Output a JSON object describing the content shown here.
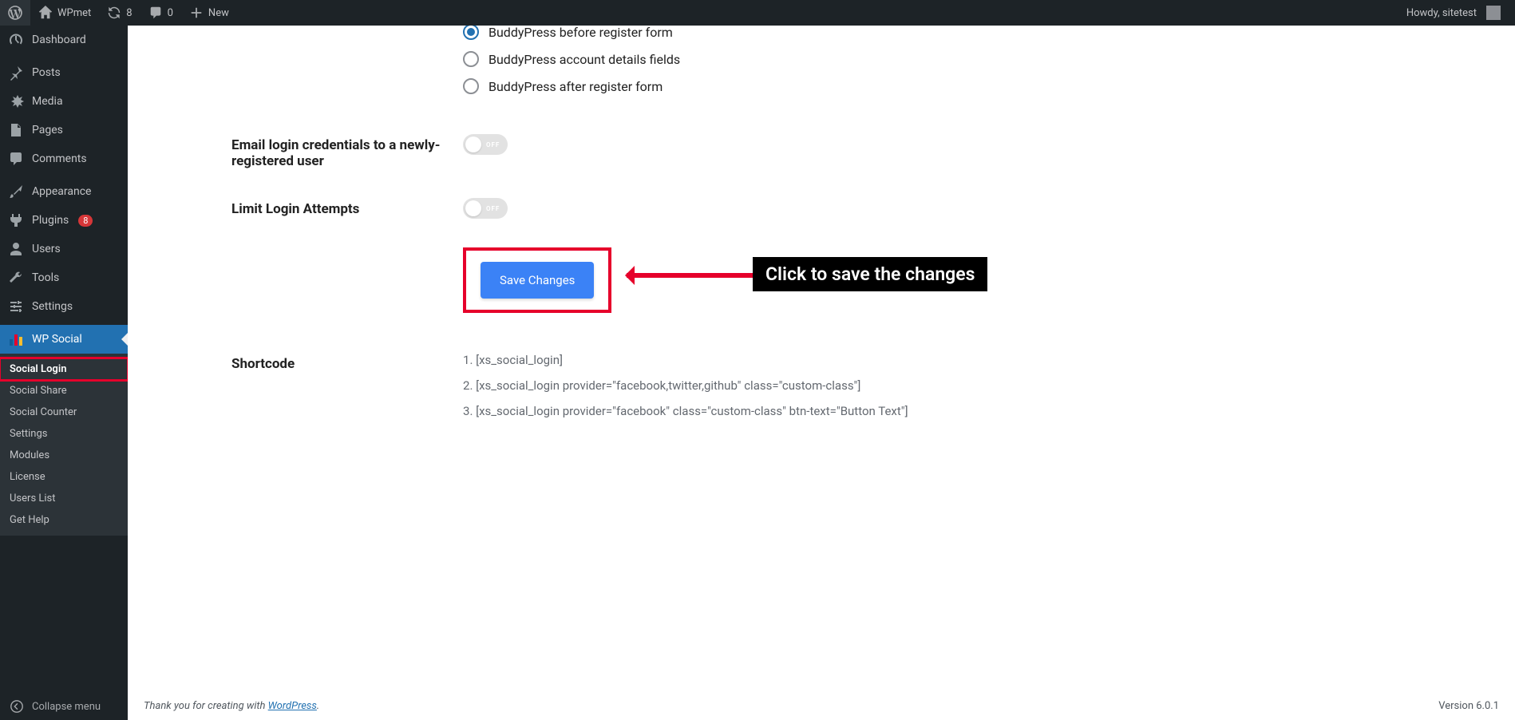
{
  "adminbar": {
    "site_name": "WPmet",
    "updates_count": "8",
    "comments_count": "0",
    "new_label": "New",
    "howdy": "Howdy, sitetest"
  },
  "sidebar": {
    "dashboard": "Dashboard",
    "posts": "Posts",
    "media": "Media",
    "pages": "Pages",
    "comments": "Comments",
    "appearance": "Appearance",
    "plugins": "Plugins",
    "plugins_badge": "8",
    "users": "Users",
    "tools": "Tools",
    "settings": "Settings",
    "wpsocial": "WP Social",
    "submenu": {
      "social_login": "Social Login",
      "social_share": "Social Share",
      "social_counter": "Social Counter",
      "settings": "Settings",
      "modules": "Modules",
      "license": "License",
      "users_list": "Users List",
      "get_help": "Get Help"
    },
    "collapse": "Collapse menu"
  },
  "form": {
    "radio1": "BuddyPress before register form",
    "radio2": "BuddyPress account details fields",
    "radio3": "BuddyPress after register form",
    "email_creds_label": "Email login credentials to a newly-registered user",
    "limit_attempts_label": "Limit Login Attempts",
    "toggle_off": "OFF",
    "save": "Save Changes",
    "callout": "Click to save the changes",
    "shortcode_label": "Shortcode",
    "sc1": "[xs_social_login]",
    "sc2": "[xs_social_login provider=\"facebook,twitter,github\" class=\"custom-class\"]",
    "sc3": "[xs_social_login provider=\"facebook\" class=\"custom-class\" btn-text=\"Button Text\"]"
  },
  "footer": {
    "thanks_pre": "Thank you for creating with ",
    "thanks_link": "WordPress",
    "thanks_post": ".",
    "version": "Version 6.0.1"
  }
}
